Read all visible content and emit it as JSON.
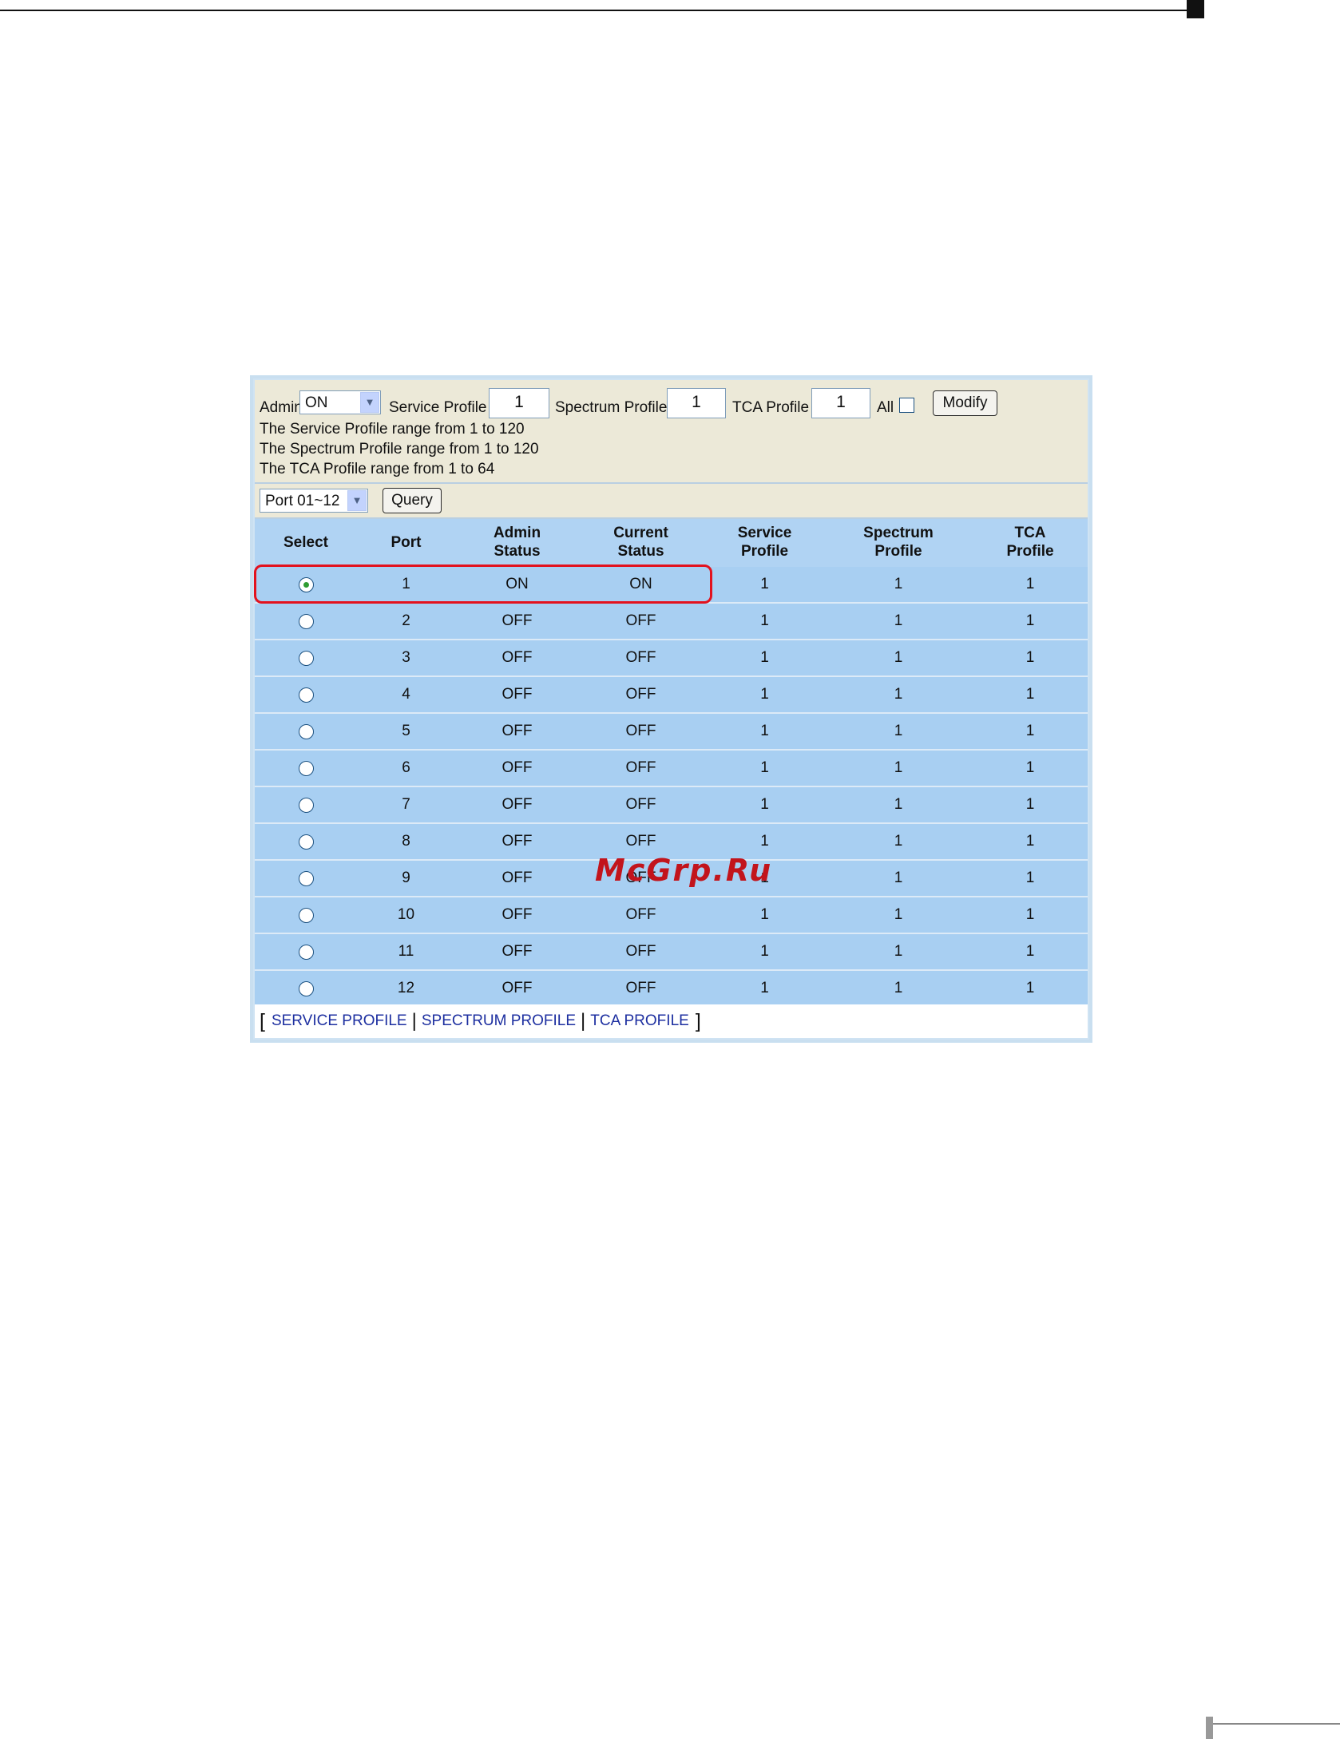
{
  "toolbar": {
    "admin_label": "Admin",
    "admin_value": "ON",
    "service_profile_label": "Service Profile",
    "service_profile_value": "1",
    "spectrum_profile_label": "Spectrum Profile",
    "spectrum_profile_value": "1",
    "tca_profile_label": "TCA Profile",
    "tca_profile_value": "1",
    "all_label": "All",
    "modify_label": "Modify",
    "ranges": [
      "The Service Profile range from 1 to 120",
      "The Spectrum Profile range from 1 to 120",
      "The TCA Profile range from 1 to 64"
    ]
  },
  "port_filter": {
    "value": "Port 01~12",
    "query_label": "Query"
  },
  "table": {
    "headers": [
      "Select",
      "Port",
      "Admin\nStatus",
      "Current\nStatus",
      "Service\nProfile",
      "Spectrum\nProfile",
      "TCA\nProfile"
    ],
    "rows": [
      {
        "port": "1",
        "admin": "ON",
        "current": "ON",
        "service": "1",
        "spectrum": "1",
        "tca": "1",
        "selected": true
      },
      {
        "port": "2",
        "admin": "OFF",
        "current": "OFF",
        "service": "1",
        "spectrum": "1",
        "tca": "1",
        "selected": false
      },
      {
        "port": "3",
        "admin": "OFF",
        "current": "OFF",
        "service": "1",
        "spectrum": "1",
        "tca": "1",
        "selected": false
      },
      {
        "port": "4",
        "admin": "OFF",
        "current": "OFF",
        "service": "1",
        "spectrum": "1",
        "tca": "1",
        "selected": false
      },
      {
        "port": "5",
        "admin": "OFF",
        "current": "OFF",
        "service": "1",
        "spectrum": "1",
        "tca": "1",
        "selected": false
      },
      {
        "port": "6",
        "admin": "OFF",
        "current": "OFF",
        "service": "1",
        "spectrum": "1",
        "tca": "1",
        "selected": false
      },
      {
        "port": "7",
        "admin": "OFF",
        "current": "OFF",
        "service": "1",
        "spectrum": "1",
        "tca": "1",
        "selected": false
      },
      {
        "port": "8",
        "admin": "OFF",
        "current": "OFF",
        "service": "1",
        "spectrum": "1",
        "tca": "1",
        "selected": false
      },
      {
        "port": "9",
        "admin": "OFF",
        "current": "OFF",
        "service": "1",
        "spectrum": "1",
        "tca": "1",
        "selected": false
      },
      {
        "port": "10",
        "admin": "OFF",
        "current": "OFF",
        "service": "1",
        "spectrum": "1",
        "tca": "1",
        "selected": false
      },
      {
        "port": "11",
        "admin": "OFF",
        "current": "OFF",
        "service": "1",
        "spectrum": "1",
        "tca": "1",
        "selected": false
      },
      {
        "port": "12",
        "admin": "OFF",
        "current": "OFF",
        "service": "1",
        "spectrum": "1",
        "tca": "1",
        "selected": false
      }
    ]
  },
  "footer": {
    "open_bracket": "[",
    "close_bracket": "]",
    "separator": "|",
    "links": [
      "SERVICE PROFILE",
      "SPECTRUM PROFILE",
      "TCA PROFILE"
    ]
  },
  "watermark": "McGrp.Ru",
  "colors": {
    "highlight": "#e3121e",
    "row_bg": "#a8cff2",
    "toolbar_bg": "#ece9d8",
    "link": "#1d2fa0"
  },
  "icons": {
    "dropdown": "chevron-down-icon"
  }
}
